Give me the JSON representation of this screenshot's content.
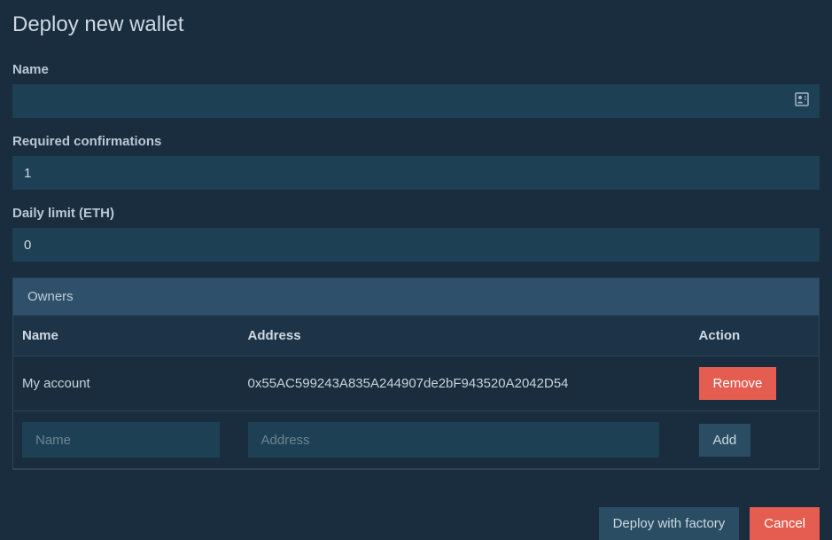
{
  "dialog": {
    "title": "Deploy new wallet"
  },
  "fields": {
    "name": {
      "label": "Name",
      "value": ""
    },
    "confirmations": {
      "label": "Required confirmations",
      "value": "1"
    },
    "dailyLimit": {
      "label": "Daily limit (ETH)",
      "value": "0"
    }
  },
  "owners": {
    "panelTitle": "Owners",
    "columns": {
      "name": "Name",
      "address": "Address",
      "action": "Action"
    },
    "rows": [
      {
        "name": "My account",
        "address": "0x55AC599243A835A244907de2bF943520A2042D54",
        "actionLabel": "Remove"
      }
    ],
    "newRow": {
      "namePlaceholder": "Name",
      "addressPlaceholder": "Address",
      "addLabel": "Add"
    }
  },
  "footer": {
    "deployLabel": "Deploy with factory",
    "cancelLabel": "Cancel"
  }
}
